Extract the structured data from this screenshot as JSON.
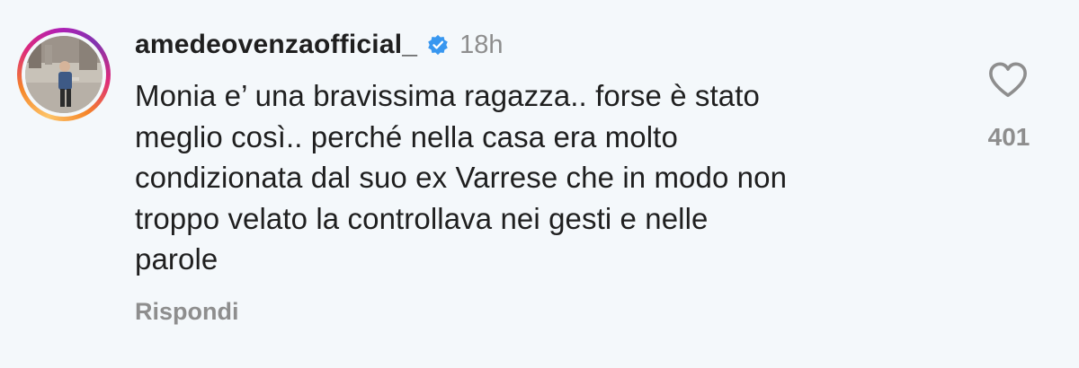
{
  "comment": {
    "username": "amedeovenzaofficial_",
    "verified": true,
    "verified_icon": "verified-badge-icon",
    "time": "18h",
    "text_lines": [
      "Monia e’ una bravissima ragazza.. forse è stato",
      "meglio così.. perché nella casa era molto",
      "condizionata dal suo ex Varrese che in modo non",
      "troppo velato la controllava nei gesti e nelle",
      "parole"
    ],
    "reply_label": "Rispondi",
    "like_icon": "heart-outline-icon",
    "like_count": "401"
  },
  "colors": {
    "background": "#f4f8fb",
    "text": "#1f1f1f",
    "muted": "#8e8e8e",
    "verified_blue": "#3897f0"
  }
}
